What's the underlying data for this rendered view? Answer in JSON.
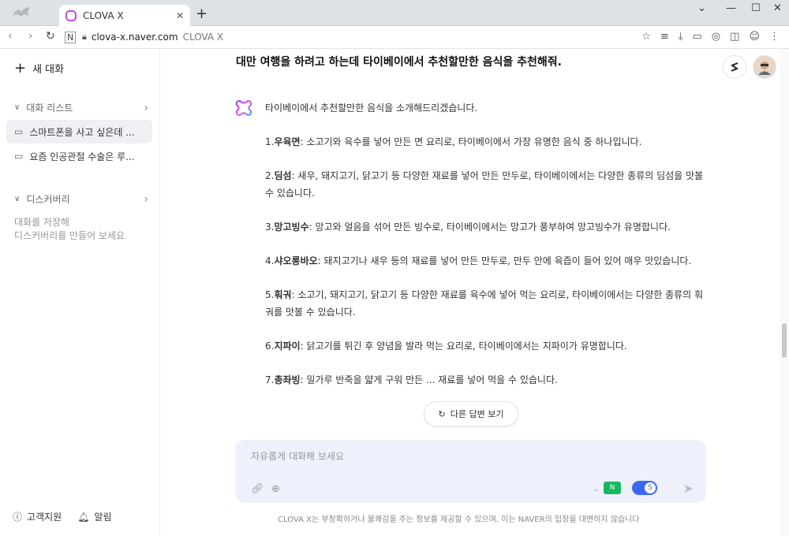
{
  "browser": {
    "tab_title": "CLOVA X",
    "url_host": "clova-x.naver.com",
    "url_title": "CLOVA X"
  },
  "sidebar": {
    "new_chat": "새 대화",
    "chat_list_label": "대화 리스트",
    "conversations": [
      "스마트폰을 사고 싶은데 ...",
      "요즘 인공관절 수술은 루..."
    ],
    "discovery_label": "디스커버리",
    "discovery_note_1": "대화를 저장해",
    "discovery_note_2": "디스커버리를 만들어 보세요",
    "support": "고객지원",
    "notifications": "알림"
  },
  "main": {
    "question": "대만 여행을 하려고 하는데 타이베이에서 추천할만한 음식을 추천해줘.",
    "intro": "타이베이에서 추천할만한 음식을 소개해드리겠습니다.",
    "items": [
      {
        "num": "1.",
        "name": "우육면",
        "desc": ": 소고기와 육수를 넣어 만든 면 요리로, 타이베이에서 가장 유명한 음식 중 하나입니다."
      },
      {
        "num": "2.",
        "name": "딤섬",
        "desc": ": 새우, 돼지고기, 닭고기 등 다양한 재료를 넣어 만든 만두로, 타이베이에서는 다양한 종류의 딤섬을 맛볼 수 있습니다."
      },
      {
        "num": "3.",
        "name": "망고빙수",
        "desc": ": 망고와 얼음을 섞어 만든 빙수로, 타이베이에서는 망고가 풍부하여 망고빙수가 유명합니다."
      },
      {
        "num": "4.",
        "name": "샤오롱바오",
        "desc": ": 돼지고기나 새우 등의 재료를 넣어 만든 만두로, 만두 안에 육즙이 들어 있어 매우 맛있습니다."
      },
      {
        "num": "5.",
        "name": "훠궈",
        "desc": ": 소고기, 돼지고기, 닭고기 등 다양한 재료를 육수에 넣어 먹는 요리로, 타이베이에서는 다양한 종류의 훠궈를 맛볼 수 있습니다."
      },
      {
        "num": "6.",
        "name": "지파이",
        "desc": ": 닭고기를 튀긴 후 양념을 발라 먹는 요리로, 타이베이에서는 지파이가 유명합니다."
      },
      {
        "num": "7.",
        "name": "총좌빙",
        "desc": ": 밀가루 반죽을 얇게 구워 만든 ... 재료를 넣어 먹을 수 있습니다."
      }
    ],
    "other_answer": "다른 답변 보기",
    "input_placeholder": "자유롭게 대화해 보세요",
    "disclaimer": "CLOVA X는 부정확하거나 불쾌감을 주는 정보를 제공할 수 있으며, 이는 NAVER의 입장을 대변하지 않습니다"
  },
  "colors": {
    "accent": "#3c67f3",
    "input_bg": "#eef1fb",
    "active_item": "#eef0f3"
  }
}
